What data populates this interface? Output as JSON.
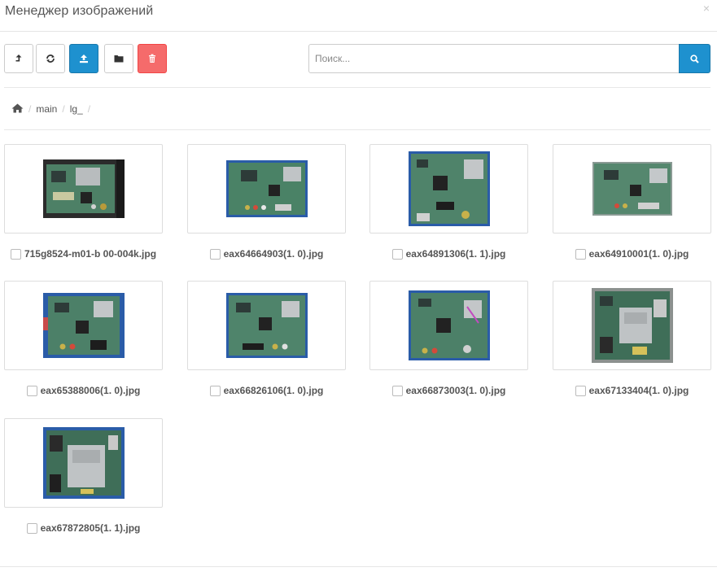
{
  "header": {
    "title": "Менеджер изображений",
    "close_symbol": "×"
  },
  "toolbar": {
    "buttons": [
      {
        "name": "parent-button",
        "icon": "level-up-icon"
      },
      {
        "name": "refresh-button",
        "icon": "refresh-icon"
      },
      {
        "name": "upload-button",
        "icon": "upload-icon",
        "color": "#1e91cf"
      },
      {
        "name": "new-folder-button",
        "icon": "folder-icon"
      },
      {
        "name": "delete-button",
        "icon": "trash-icon",
        "color": "#f56b6b"
      }
    ],
    "search": {
      "value": "",
      "placeholder": "Поиск..."
    },
    "search_button_icon": "search-icon"
  },
  "breadcrumb": {
    "home_icon": "home-icon",
    "items": [
      "main",
      "lg_"
    ],
    "separator": "/"
  },
  "images": [
    {
      "filename": "715g8524-m01-b 00-004k.jpg"
    },
    {
      "filename": "eax64664903(1. 0).jpg"
    },
    {
      "filename": "eax64891306(1. 1).jpg"
    },
    {
      "filename": "eax64910001(1. 0).jpg"
    },
    {
      "filename": "eax65388006(1. 0).jpg"
    },
    {
      "filename": "eax66826106(1. 0).jpg"
    },
    {
      "filename": "eax66873003(1. 0).jpg"
    },
    {
      "filename": "eax67133404(1. 0).jpg"
    },
    {
      "filename": "eax67872805(1. 1).jpg"
    }
  ],
  "colors": {
    "primary": "#1e91cf",
    "danger": "#f56b6b",
    "pcb_green": "#3f7a5a",
    "pcb_blue_bg": "#2a5ca8"
  }
}
